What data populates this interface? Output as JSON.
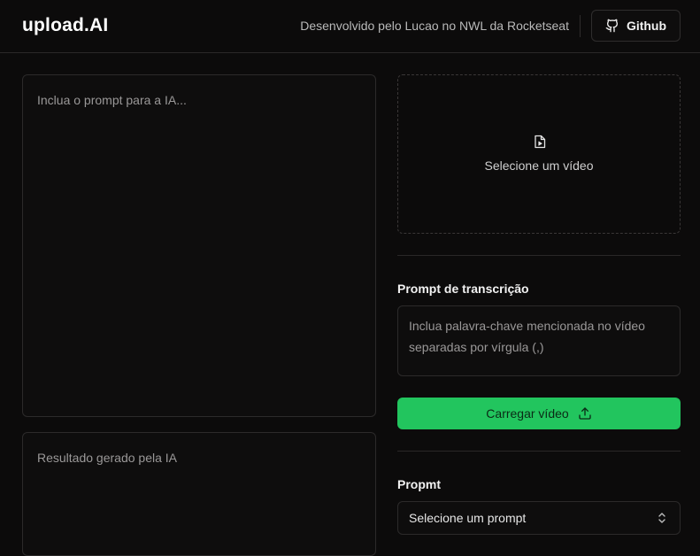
{
  "header": {
    "brand": "upload.AI",
    "credit": "Desenvolvido pelo Lucao no NWL da Rocketseat",
    "github_label": "Github"
  },
  "editor": {
    "prompt_placeholder": "Inclua o prompt para a IA...",
    "result_placeholder": "Resultado gerado pela IA"
  },
  "video": {
    "select_label": "Selecione um vídeo",
    "icon": "file-video-icon"
  },
  "transcription": {
    "label": "Prompt de transcrição",
    "placeholder": "Inclua palavra-chave mencionada no vídeo separadas por vírgula (,)"
  },
  "upload": {
    "label": "Carregar vídeo",
    "icon": "upload-icon"
  },
  "prompt_select": {
    "label": "Propmt",
    "value": "Selecione um prompt"
  },
  "colors": {
    "background": "#0c0b0b",
    "accent": "#22c55e",
    "border": "#2c2a2a"
  }
}
